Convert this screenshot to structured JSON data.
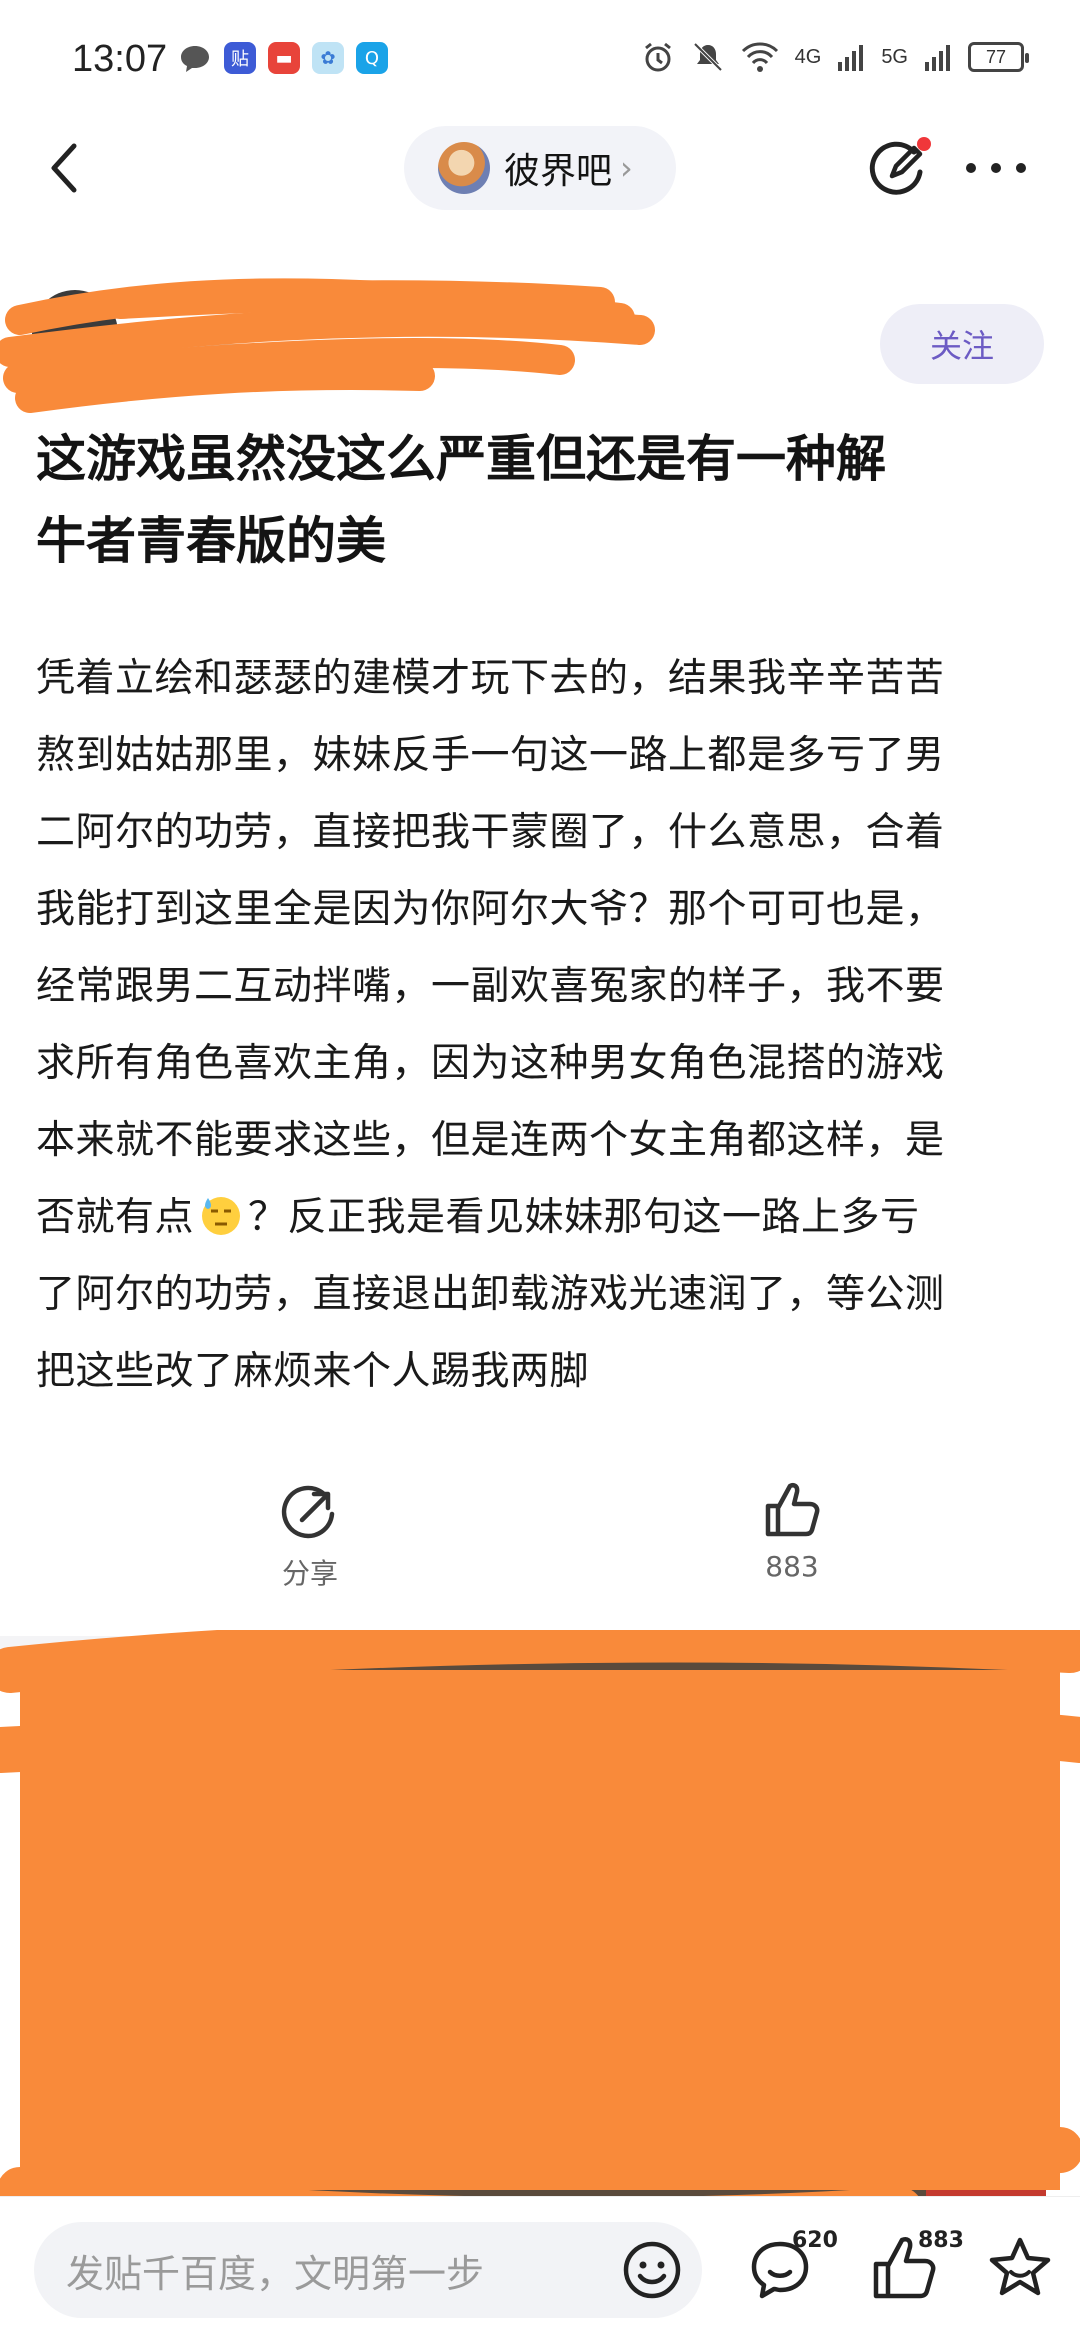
{
  "status_bar": {
    "time": "13:07",
    "network_labels": [
      "4G",
      "5G"
    ],
    "battery": "77"
  },
  "nav": {
    "forum_name": "彼界吧",
    "chevron": "›"
  },
  "author": {
    "follow_label": "关注"
  },
  "post": {
    "title_lines": [
      "这游戏虽然没这么严重但还是有一种解",
      "牛者青春版的美"
    ],
    "body_lines": [
      "凭着立绘和瑟瑟的建模才玩下去的，结果我辛辛苦苦",
      "熬到姑姑那里，妹妹反手一句这一路上都是多亏了男",
      "二阿尔的功劳，直接把我干蒙圈了，什么意思，合着",
      "我能打到这里全是因为你阿尔大爷？那个可可也是，",
      "经常跟男二互动拌嘴，一副欢喜冤家的样子，我不要",
      "求所有角色喜欢主角，因为这种男女角色混搭的游戏",
      "本来就不能要求这些，但是连两个女主角都这样，是"
    ],
    "body_line8_pre": "否就有点",
    "body_line8_post": "？反正我是看见妹妹那句这一路上多亏",
    "body_lines_tail": [
      "了阿尔的功劳，直接退出卸载游戏光速润了，等公测",
      "把这些改了麻烦来个人踢我两脚"
    ]
  },
  "actions": {
    "share_label": "分享",
    "like_count": "883"
  },
  "bottom_bar": {
    "input_placeholder": "发贴千百度，文明第一步",
    "comment_count": "620",
    "like_count": "883"
  },
  "colors": {
    "accent": "#6c5bc4",
    "scribble": "#f98a3a"
  }
}
